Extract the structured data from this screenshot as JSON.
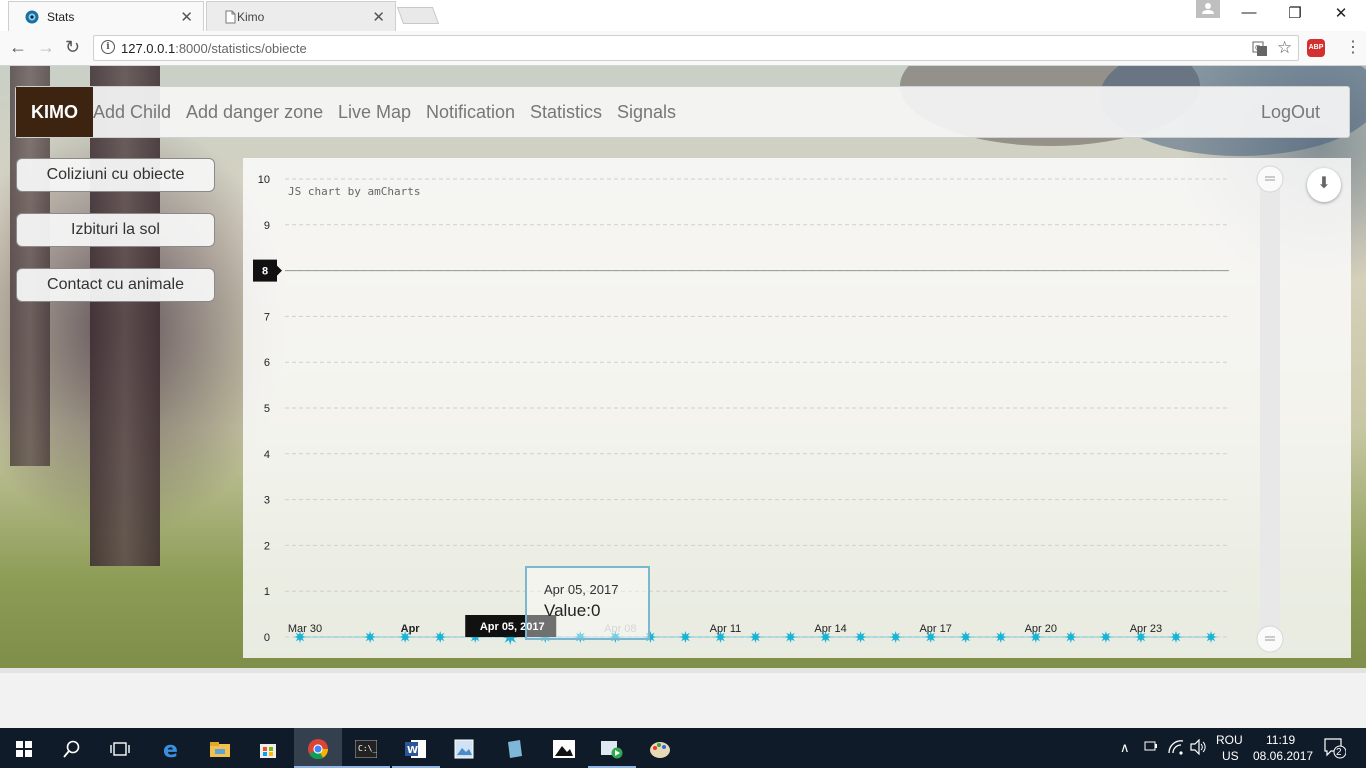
{
  "browser": {
    "tabs": [
      {
        "title": "Stats",
        "active": true,
        "icon": "stats-favicon-icon"
      },
      {
        "title": "Kimo",
        "active": false,
        "icon": "page-icon"
      }
    ],
    "url_host": "127.0.0.1",
    "url_path": ":8000/statistics/obiecte",
    "abp_label": "ABP"
  },
  "navbar": {
    "brand": "KIMO",
    "links": [
      "Add Child",
      "Add danger zone",
      "Live Map",
      "Notification",
      "Statistics",
      "Signals"
    ],
    "logout": "LogOut"
  },
  "sidebar": {
    "buttons": [
      "Coliziuni cu obiecte",
      "Izbituri la sol",
      "Contact cu animale"
    ]
  },
  "chart_data": {
    "type": "line",
    "credit": "JS chart by amCharts",
    "y_ticks": [
      "0",
      "1",
      "2",
      "3",
      "4",
      "5",
      "6",
      "7",
      "8",
      "9",
      "10"
    ],
    "ylim": [
      0,
      10
    ],
    "x_labels": [
      "Mar 30",
      "Apr",
      "Apr 05, 2017",
      "Apr 08",
      "Apr 11",
      "Apr 14",
      "Apr 17",
      "Apr 20",
      "Apr 23"
    ],
    "x_dates": [
      "2017-03-30",
      "2017-04-01",
      "2017-04-02",
      "2017-04-03",
      "2017-04-04",
      "2017-04-05",
      "2017-04-06",
      "2017-04-07",
      "2017-04-08",
      "2017-04-09",
      "2017-04-10",
      "2017-04-11",
      "2017-04-12",
      "2017-04-13",
      "2017-04-14",
      "2017-04-15",
      "2017-04-16",
      "2017-04-17",
      "2017-04-18",
      "2017-04-19",
      "2017-04-20",
      "2017-04-21",
      "2017-04-22",
      "2017-04-23",
      "2017-04-24",
      "2017-04-25"
    ],
    "values": [
      0,
      0,
      0,
      0,
      0,
      0,
      0,
      0,
      0,
      0,
      0,
      0,
      0,
      0,
      0,
      0,
      0,
      0,
      0,
      0,
      0,
      0,
      0,
      0,
      0,
      0
    ],
    "guide_value": "8",
    "balloon": {
      "date": "Apr 05, 2017",
      "value": "Value:0"
    },
    "cursor_label": "Apr 05, 2017",
    "marker_color": "#1ab3d6",
    "grid": true
  },
  "taskbar": {
    "lang": "ROU",
    "layout": "US",
    "time": "11:19",
    "date": "08.06.2017",
    "notifications": "2"
  }
}
